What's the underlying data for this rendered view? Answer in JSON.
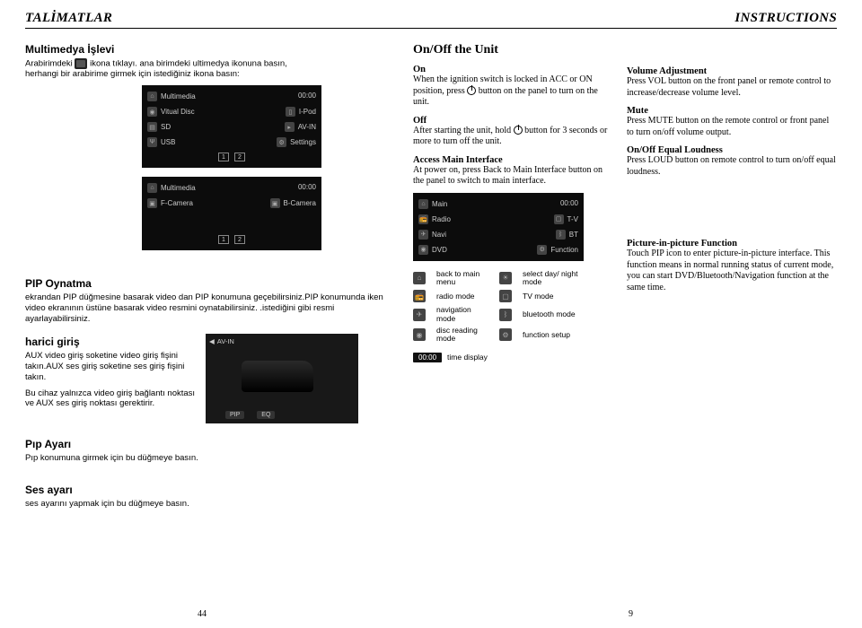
{
  "header": {
    "left": "TALİMATLAR",
    "right": "INSTRUCTIONS"
  },
  "left": {
    "mm_title": "Multimedya İşlevi",
    "mm_line1a": "Arabirimdeki",
    "mm_line1b": "ikona tıklayı. ana birimdeki ultimedya ikonuna basın,",
    "mm_line2": "herhangi bir arabirime girmek için istediğiniz ikona basın:",
    "screen": {
      "mm_label": "Multimedia",
      "time": "00:00",
      "items": [
        "Vitual Disc",
        "I-Pod",
        "SD",
        "AV-IN",
        "USB",
        "Settings",
        "F-Camera",
        "B-Camera"
      ],
      "nums": [
        "1",
        "2"
      ]
    },
    "pip_play_h": "PIP Oynatma",
    "pip_play_p": "ekrandan PIP düğmesine basarak video dan PIP konumuna geçebilirsiniz.PIP konumunda iken  video ekranının  üstüne basarak  video resmini oynatabilirsiniz. .istediğini gibi resmi ayarlayabilirsiniz.",
    "ext_h": "harici giriş",
    "ext_p": "AUX video giriş soketine video giriş fişini takın.AUX ses giriş soketine ses giriş fişini takın.",
    "ext_p2": "Bu cihaz yalnızca video giriş bağlantı noktası ve AUX ses giriş noktası gerektirir.",
    "avin": {
      "title": "AV-IN",
      "pip": "PIP",
      "eq": "EQ"
    },
    "pip_set_h": "Pıp Ayarı",
    "pip_set_p": "Pıp konumuna girmek için bu düğmeye basın.",
    "snd_h": "Ses ayarı",
    "snd_p": "ses ayarını yapmak için bu düğmeye basın."
  },
  "right": {
    "title": "On/Off the Unit",
    "on_h": "On",
    "on_p1": "When the ignition switch is locked in ACC or ON position, press",
    "on_p2": "button on the panel to turn on the unit.",
    "off_h": "Off",
    "off_p1": "After starting the unit, hold",
    "off_p2": "button for 3 seconds or more to turn off the unit.",
    "ami_h": "Access Main Interface",
    "ami_p": "At power on, press Back to Main Interface button on the panel to switch to main interface.",
    "main_screen": {
      "main": "Main",
      "time": "00:00",
      "rows": [
        [
          "Radio",
          "T-V"
        ],
        [
          "Navi",
          "BT"
        ],
        [
          "DVD",
          "Function"
        ]
      ]
    },
    "modes": {
      "back": "back to main menu",
      "day": "select day/ night mode",
      "radio": "radio mode",
      "tv": "TV mode",
      "nav": "navigation mode",
      "bt": "bluetooth mode",
      "disc": "disc reading mode",
      "func": "function setup",
      "time_lbl": "time display",
      "time_val": "00:00"
    },
    "vol_h": "Volume Adjustment",
    "vol_p": "Press VOL button on the front panel or remote control to increase/decrease volume level.",
    "mute_h": "Mute",
    "mute_p": "Press MUTE button on the remote control or front panel to turn on/off volume output.",
    "loud_h": "On/Off Equal Loudness",
    "loud_p": "Press LOUD button on remote control to turn on/off equal loudness.",
    "pip_h": "Picture-in-picture Function",
    "pip_p": "Touch PIP  icon to enter picture-in-picture interface. This function means in normal running status of current mode, you can start DVD/Bluetooth/Navigation function at the same time."
  },
  "pages": {
    "left": "44",
    "right": "9"
  }
}
